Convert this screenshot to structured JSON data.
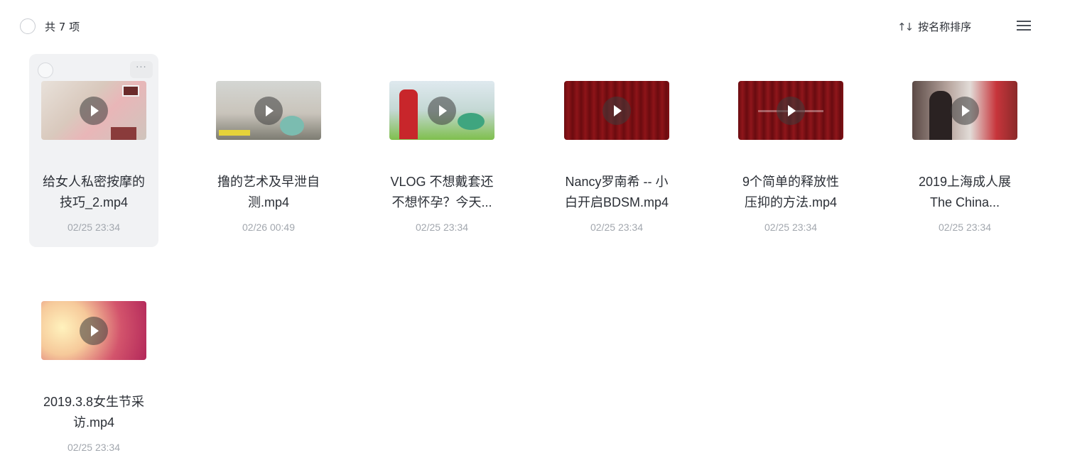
{
  "toolbar": {
    "count_label": "共 7 项",
    "sort_icon_glyph": "↑↓",
    "sort_label": "按名称排序",
    "view_icon": "list-menu-icon"
  },
  "files": [
    {
      "name": "给女人私密按摩的技巧_2.mp4",
      "line1": "给女人私密按摩的",
      "line2": "技巧_2.mp4",
      "date": "02/25 23:34",
      "selected": true
    },
    {
      "name": "撸的艺术及早泄自测.mp4",
      "line1": "撸的艺术及早泄自",
      "line2": "测.mp4",
      "date": "02/26 00:49"
    },
    {
      "name": "VLOG 不想戴套还不想怀孕？今天...",
      "line1": "VLOG 不想戴套还",
      "line2": "不想怀孕？今天...",
      "date": "02/25 23:34"
    },
    {
      "name": "Nancy罗南希 -- 小白开启BDSM.mp4",
      "line1": "Nancy罗南希 -- 小",
      "line2": "白开启BDSM.mp4",
      "date": "02/25 23:34"
    },
    {
      "name": "9个简单的释放性压抑的方法.mp4",
      "line1": "9个简单的释放性",
      "line2": "压抑的方法.mp4",
      "date": "02/25 23:34"
    },
    {
      "name": "2019上海成人展 The China...",
      "line1": "2019上海成人展",
      "line2": "The China...",
      "date": "02/25 23:34"
    },
    {
      "name": "2019.3.8女生节采访.mp4",
      "line1": "2019.3.8女生节采",
      "line2": "访.mp4",
      "date": "02/25 23:34"
    }
  ],
  "card_more_glyph": "···"
}
